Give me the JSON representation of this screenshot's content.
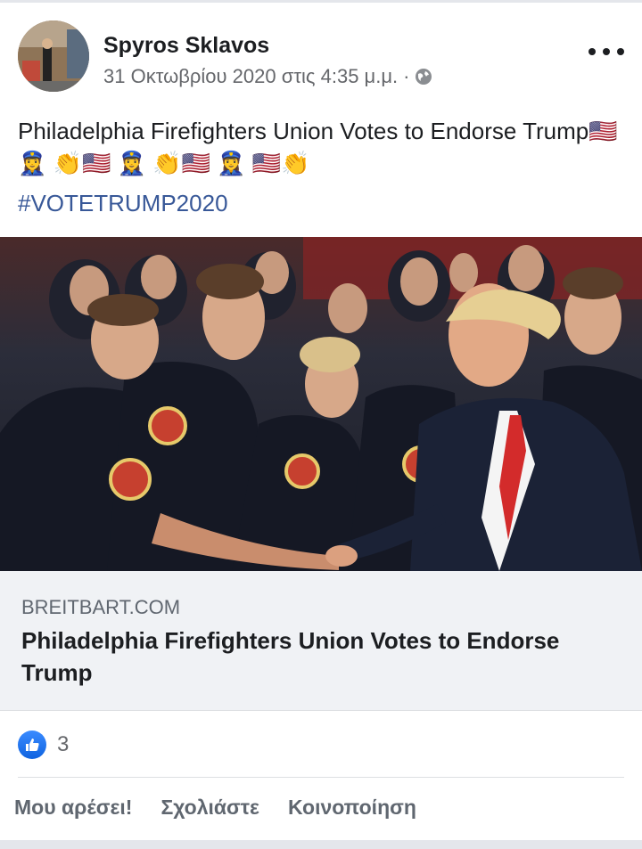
{
  "post": {
    "author": "Spyros Sklavos",
    "timestamp": "31 Οκτωβρίου 2020 στις 4:35 μ.μ.",
    "separator": "·",
    "privacy_icon": "globe-icon",
    "more_icon": "more-options-icon",
    "text_line": "Philadelphia Firefighters Union Votes to Endorse Trump",
    "emojis": "🇺🇸 👮‍♀️ 👏🇺🇸 👮‍♀️ 👏🇺🇸 👮‍♀️ 🇺🇸👏",
    "hashtag": "#VOTETRUMP2020"
  },
  "link_preview": {
    "domain": "BREITBART.COM",
    "title": "Philadelphia Firefighters Union Votes to Endorse Trump"
  },
  "reactions": {
    "icon": "like-icon",
    "count": "3"
  },
  "actions": {
    "like": "Μου αρέσει!",
    "comment": "Σχολιάστε",
    "share": "Κοινοποίηση"
  },
  "colors": {
    "hashtag": "#385898",
    "like_blue": "#1877f2",
    "card_bg": "#f0f2f5"
  }
}
